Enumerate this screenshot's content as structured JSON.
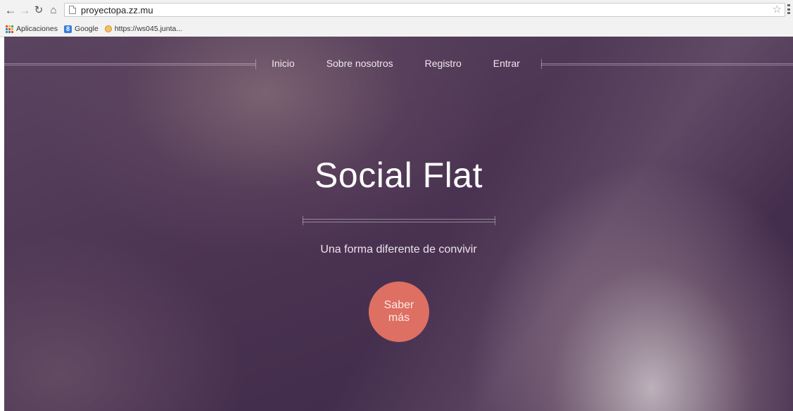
{
  "browser": {
    "url": "proyectopa.zz.mu",
    "bookmarks": [
      {
        "label": "Aplicaciones",
        "icon": "apps-icon"
      },
      {
        "label": "Google",
        "icon": "google-icon"
      },
      {
        "label": "https://ws045.junta...",
        "icon": "junta-favicon-icon"
      }
    ]
  },
  "nav": {
    "items": [
      "Inicio",
      "Sobre nosotros",
      "Registro",
      "Entrar"
    ]
  },
  "hero": {
    "title": "Social Flat",
    "subtitle": "Una forma diferente de convivir",
    "cta_label": "Saber más"
  },
  "colors": {
    "cta": "#dd6f63",
    "background": "#4b3452"
  }
}
